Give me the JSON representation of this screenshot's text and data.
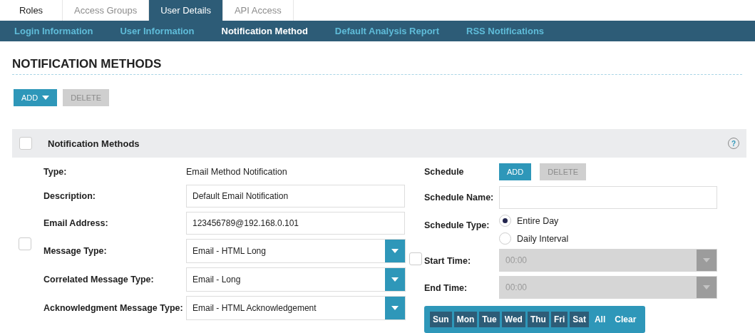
{
  "tabs": [
    {
      "label": "Roles",
      "selected": false,
      "kind": "plain"
    },
    {
      "label": "Access Groups",
      "selected": false,
      "kind": "muted"
    },
    {
      "label": "User Details",
      "selected": true,
      "kind": "muted"
    },
    {
      "label": "API Access",
      "selected": false,
      "kind": "muted"
    }
  ],
  "subtabs": [
    {
      "label": "Login Information",
      "selected": false
    },
    {
      "label": "User Information",
      "selected": false
    },
    {
      "label": "Notification Method",
      "selected": true
    },
    {
      "label": "Default Analysis Report",
      "selected": false
    },
    {
      "label": "RSS Notifications",
      "selected": false
    }
  ],
  "heading": "NOTIFICATION METHODS",
  "toolbar": [
    {
      "label": "ADD",
      "disabled": false,
      "caret": true
    },
    {
      "label": "DELETE",
      "disabled": true,
      "caret": false
    }
  ],
  "panel": {
    "checked": false,
    "title": "Notification Methods",
    "help": "?"
  },
  "row_checked": false,
  "fields": [
    {
      "label": "Type:",
      "kind": "text",
      "value": "Email Method Notification"
    },
    {
      "label": "Description:",
      "kind": "input",
      "value": "Default Email Notification"
    },
    {
      "label": "Email Address:",
      "kind": "input",
      "value": "123456789@192.168.0.101"
    },
    {
      "label": "Message Type:",
      "kind": "select",
      "value": "Email - HTML Long"
    },
    {
      "label": "Correlated Message Type:",
      "kind": "select",
      "value": "Email - Long"
    },
    {
      "label": "Acknowledgment Message Type:",
      "kind": "select",
      "value": "Email - HTML Acknowledgement"
    }
  ],
  "schedule": {
    "checked": false,
    "label": "Schedule",
    "buttons": [
      {
        "label": "ADD",
        "disabled": false
      },
      {
        "label": "DELETE",
        "disabled": true
      }
    ],
    "name_label": "Schedule Name:",
    "type_label": "Schedule Type:",
    "types": [
      {
        "label": "Entire Day",
        "selected": true
      },
      {
        "label": "Daily Interval",
        "selected": false
      }
    ],
    "times": [
      {
        "label": "Start Time:",
        "value": "00:00",
        "disabled": true
      },
      {
        "label": "End Time:",
        "value": "00:00",
        "disabled": true
      }
    ],
    "days": [
      {
        "label": "Sun",
        "kind": "day",
        "selected": true
      },
      {
        "label": "Mon",
        "kind": "day",
        "selected": true
      },
      {
        "label": "Tue",
        "kind": "day",
        "selected": true
      },
      {
        "label": "Wed",
        "kind": "day",
        "selected": true
      },
      {
        "label": "Thu",
        "kind": "day",
        "selected": true
      },
      {
        "label": "Fri",
        "kind": "day",
        "selected": true
      },
      {
        "label": "Sat",
        "kind": "day",
        "selected": true
      },
      {
        "label": "All",
        "kind": "action",
        "selected": false
      },
      {
        "label": "Clear",
        "kind": "action",
        "selected": false
      }
    ]
  }
}
